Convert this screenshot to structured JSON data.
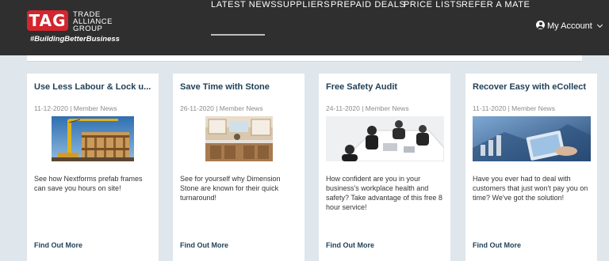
{
  "brand": {
    "badge": "TAG",
    "name_lines": [
      "TRADE",
      "ALLIANCE",
      "GROUP"
    ],
    "tagline": "#BuildingBetterBusiness",
    "badge_color": "#d3262e"
  },
  "nav": {
    "items": [
      {
        "label": "LATEST NEWS",
        "active": true
      },
      {
        "label": "SUPPLIERS",
        "active": false
      },
      {
        "label": "PREPAID DEALS",
        "active": false
      },
      {
        "label": "PRICE LISTS",
        "active": false
      },
      {
        "label": "REFER A MATE",
        "active": false
      }
    ],
    "account_label": "My Account",
    "account_icon": "user-circle-icon"
  },
  "colors": {
    "header_bg": "#2f2f2f",
    "page_bg": "#dfe6ec",
    "title": "#1e3f57"
  },
  "cards": [
    {
      "title": "Use Less Labour & Lock u...",
      "meta": "11-12-2020 | Member News",
      "image": "construction-crane-image",
      "body": "See how Nextforms prefab frames can save you hours on site!",
      "link": "Find Out More"
    },
    {
      "title": "Save Time with Stone",
      "meta": "26-11-2020 | Member News",
      "image": "kitchen-image",
      "body": "See for yourself why Dimension Stone are known for their quick turnaround!",
      "link": "Find Out More"
    },
    {
      "title": "Free Safety Audit",
      "meta": "24-11-2020 | Member News",
      "image": "meeting-table-image",
      "body": "How confident are you in your business's workplace health and safety? Take advantage of this free 8 hour service!",
      "link": "Find Out More"
    },
    {
      "title": "Recover Easy with eCollect",
      "meta": "11-11-2020 | Member News",
      "image": "tablet-business-image",
      "body": "Have you ever had to deal with customers that just won't pay you on time? We've got the solution!",
      "link": "Find Out More"
    }
  ]
}
